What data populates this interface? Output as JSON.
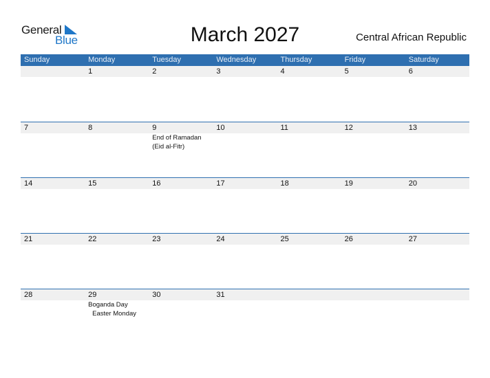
{
  "logo": {
    "general": "General",
    "blue": "Blue",
    "accent": "#1f77c8"
  },
  "title": "March 2027",
  "country": "Central African Republic",
  "colors": {
    "header_bg": "#2e6fb0",
    "day_strip_bg": "#f0f0f0"
  },
  "weekdays": [
    "Sunday",
    "Monday",
    "Tuesday",
    "Wednesday",
    "Thursday",
    "Friday",
    "Saturday"
  ],
  "weeks": [
    {
      "days": [
        "",
        "1",
        "2",
        "3",
        "4",
        "5",
        "6"
      ],
      "events": [
        [],
        [],
        [],
        [],
        [],
        [],
        []
      ]
    },
    {
      "days": [
        "7",
        "8",
        "9",
        "10",
        "11",
        "12",
        "13"
      ],
      "events": [
        [],
        [],
        [
          "End of Ramadan",
          "(Eid al-Fitr)"
        ],
        [],
        [],
        [],
        []
      ]
    },
    {
      "days": [
        "14",
        "15",
        "16",
        "17",
        "18",
        "19",
        "20"
      ],
      "events": [
        [],
        [],
        [],
        [],
        [],
        [],
        []
      ]
    },
    {
      "days": [
        "21",
        "22",
        "23",
        "24",
        "25",
        "26",
        "27"
      ],
      "events": [
        [],
        [],
        [],
        [],
        [],
        [],
        []
      ]
    },
    {
      "days": [
        "28",
        "29",
        "30",
        "31",
        "",
        "",
        ""
      ],
      "events": [
        [],
        [
          "Boganda Day",
          "Easter Monday"
        ],
        [],
        [],
        [],
        [],
        []
      ]
    }
  ]
}
